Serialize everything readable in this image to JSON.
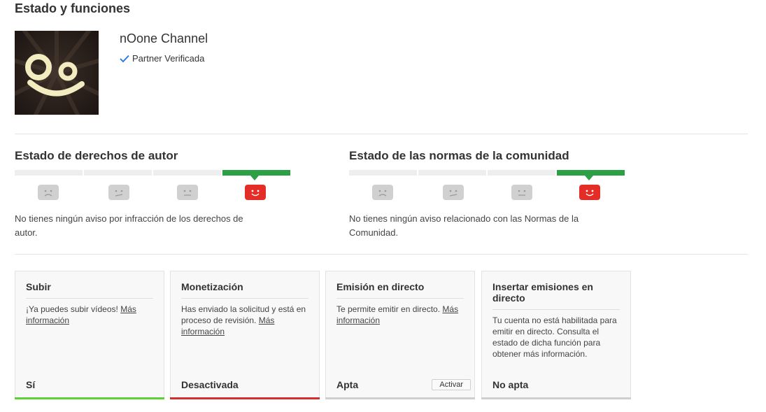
{
  "page": {
    "title": "Estado y funciones"
  },
  "channel": {
    "name": "nOone Channel",
    "partner_label": "Partner Verificada"
  },
  "copyright": {
    "title": "Estado de derechos de autor",
    "text": "No tienes ningún aviso por infracción de los derechos de autor."
  },
  "community": {
    "title": "Estado de las normas de la comunidad",
    "text": "No tienes ningún aviso relacionado con las Normas de la Comunidad."
  },
  "colors": {
    "good": "#2ba045",
    "bad": "#d32f2f",
    "neutral": "#d0d0d0",
    "happy_face": "#e52d27"
  },
  "cards": [
    {
      "title": "Subir",
      "body": "¡Ya puedes subir vídeos!",
      "link": "Más información",
      "status": "Sí",
      "line_color": "#5cd035"
    },
    {
      "title": "Monetización",
      "body": "Has enviado la solicitud y está en proceso de revisión.",
      "link": "Más información",
      "status": "Desactivada",
      "line_color": "#d32f2f"
    },
    {
      "title": "Emisión en directo",
      "body": "Te permite emitir en directo.",
      "link": "Más información",
      "status": "Apta",
      "button": "Activar",
      "line_color": "#cfcfcf"
    },
    {
      "title": "Insertar emisiones en directo",
      "body": "Tu cuenta no está habilitada para emitir en directo. Consulta el estado de dicha función para obtener más información.",
      "status": "No apta",
      "line_color": "#cfcfcf"
    }
  ]
}
